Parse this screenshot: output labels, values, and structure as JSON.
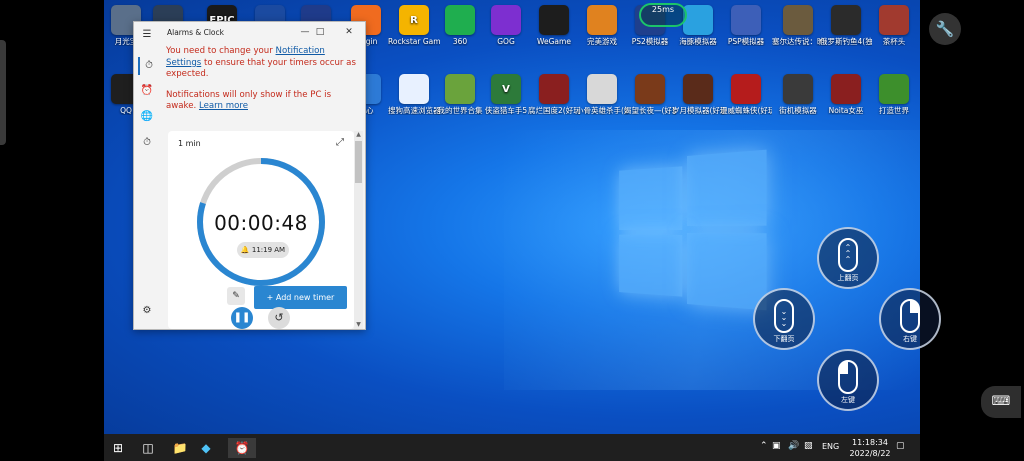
{
  "desktop_icons_row1": [
    {
      "label": "月光宝",
      "color": "#5a6f8a",
      "icon": "gem-icon"
    },
    {
      "label": "",
      "color": "#2b3e57",
      "icon": "steam-icon"
    },
    {
      "label": "",
      "color": "#1a1a1a",
      "icon": "epic-icon",
      "text": "EPIC"
    },
    {
      "label": "",
      "color": "#1b4aa0",
      "icon": "network-icon"
    },
    {
      "label": "",
      "color": "#1f3b8a",
      "icon": "uplay-icon"
    },
    {
      "label": "Origin",
      "color": "#f06b1f",
      "icon": "origin-icon"
    },
    {
      "label": "Rockstar Games",
      "color": "#f4b400",
      "icon": "rockstar-icon",
      "text": "R"
    },
    {
      "label": "360",
      "color": "#1fae4f",
      "icon": "360-icon"
    },
    {
      "label": "GOG",
      "color": "#7d2fd0",
      "icon": "gog-icon"
    },
    {
      "label": "WeGame",
      "color": "#1d1d1d",
      "icon": "wegame-icon"
    },
    {
      "label": "完美游戏",
      "color": "#e0821f",
      "icon": "perfect-icon"
    },
    {
      "label": "PS2模拟器",
      "color": "#1f3f8c",
      "icon": "ps2-icon"
    },
    {
      "label": "海豚模拟器",
      "color": "#2aa1e0",
      "icon": "dolphin-icon"
    },
    {
      "label": "PSP模拟器",
      "color": "#3d5fb8",
      "icon": "psp-icon"
    },
    {
      "label": "塞尔达传说：旷野…",
      "color": "#6b5b3e",
      "icon": "zelda-icon"
    },
    {
      "label": "俄罗斯钓鱼4(独立版)",
      "color": "#2b2b2b",
      "icon": "fishing-icon"
    },
    {
      "label": "茶杯头",
      "color": "#a13a2f",
      "icon": "cuphead-icon"
    }
  ],
  "desktop_icons_row2": [
    {
      "label": "QQ",
      "color": "#1f1f1f",
      "icon": "qq-icon"
    },
    {
      "label": "中心",
      "color": "#2d7ad6",
      "icon": "center-icon"
    },
    {
      "label": "搜狗高速浏览器",
      "color": "#e8f1ff",
      "icon": "sogou-icon"
    },
    {
      "label": "我的世界合集",
      "color": "#6aa33c",
      "icon": "minecraft-icon"
    },
    {
      "label": "侠盗猎车手5",
      "color": "#2d7a3a",
      "icon": "gta5-icon",
      "text": "V"
    },
    {
      "label": "腐烂国度2(好玩可…",
      "color": "#8a1f1f",
      "icon": "state-of-decay-icon"
    },
    {
      "label": "小骨英雄杀手(好玩…",
      "color": "#d8d8d8",
      "icon": "skul-icon"
    },
    {
      "label": "渴望长夜—(好玩可…",
      "color": "#7a3a1a",
      "icon": "long-dark-icon"
    },
    {
      "label": "岁月模拟器(好玩可…",
      "color": "#5a2b1a",
      "icon": "sim-icon"
    },
    {
      "label": "漫威蜘蛛侠(好玩可…",
      "color": "#b51c1c",
      "icon": "spiderman-icon"
    },
    {
      "label": "街机模拟器",
      "color": "#3a3a3a",
      "icon": "arcade-icon"
    },
    {
      "label": "Noita女巫",
      "color": "#8a1f1f",
      "icon": "noita-icon"
    },
    {
      "label": "打造世界",
      "color": "#3d8f2c",
      "icon": "craft-icon"
    }
  ],
  "fps_overlay": {
    "label": "25ms"
  },
  "alarm_window": {
    "title": "Alarms & Clock",
    "notice1_a": "You need to change your ",
    "notice1_link": "Notification Settings",
    "notice1_b": " to ensure that your timers occur as expected.",
    "notice2_a": "Notifications will only show if the PC is awake. ",
    "notice2_link": "Learn more",
    "timer_title": "1 min",
    "timer_value": "00:00:48",
    "timer_remaining_fraction": 0.8,
    "alarm_time": "11:19 AM",
    "add_timer_label": "Add new timer"
  },
  "taskbar": {
    "lang": "ENG",
    "time": "11:18:34",
    "date": "2022/8/22"
  },
  "gesture_buttons": {
    "page_up": "上翻页",
    "page_down": "下翻页",
    "right_click": "右键",
    "left_click": "左键"
  },
  "colors": {
    "accent": "#2a86d1",
    "warning_text": "#c42b1c",
    "taskbar": "#1f1f1f"
  }
}
